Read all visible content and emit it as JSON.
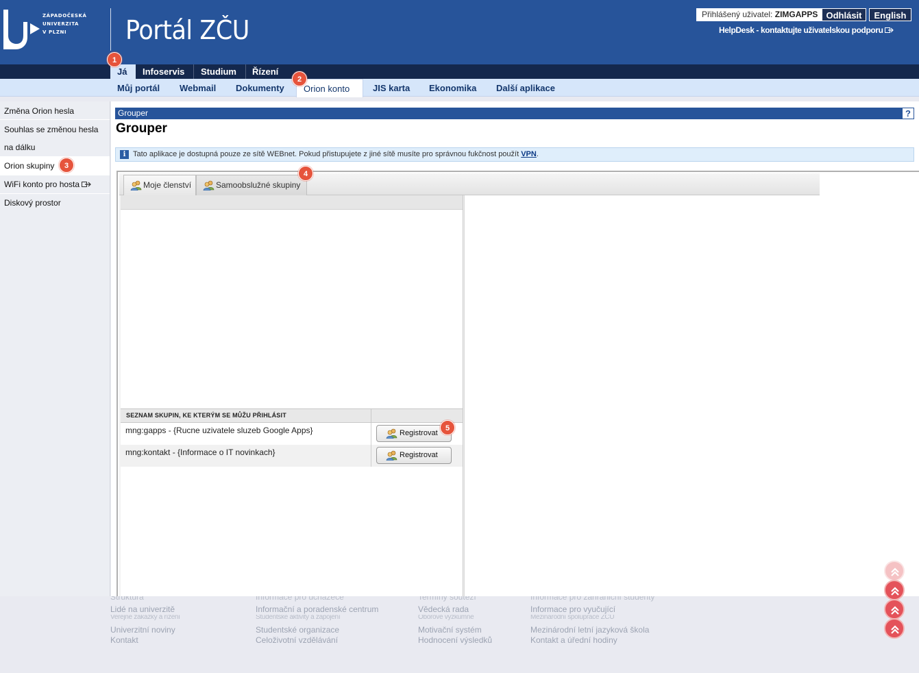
{
  "header": {
    "logo_lines": [
      "ZÁPADOČESKÁ",
      "UNIVERZITA",
      "V PLZNI"
    ],
    "portal_title": "Portál ZČU",
    "user_label": "Přihlášený uživatel:",
    "user_name": "ZIMGAPPS",
    "logout": "Odhlásit",
    "language": "English",
    "helpdesk": "HelpDesk - kontaktujte uživatelskou podporu"
  },
  "topnav": {
    "items": [
      {
        "label": "Já",
        "active": true
      },
      {
        "label": "Infoservis",
        "active": false
      },
      {
        "label": "Studium",
        "active": false
      },
      {
        "label": "Řízení",
        "active": false
      }
    ]
  },
  "subnav": {
    "items": [
      {
        "label": "Můj portál",
        "active": false
      },
      {
        "label": "Webmail",
        "active": false
      },
      {
        "label": "Dokumenty",
        "active": false
      },
      {
        "label": "Orion konto",
        "active": true
      },
      {
        "label": "JIS karta",
        "active": false
      },
      {
        "label": "Ekonomika",
        "active": false
      },
      {
        "label": "Další aplikace",
        "active": false
      }
    ]
  },
  "sidebar": {
    "items": [
      {
        "label": "Změna Orion hesla",
        "active": false
      },
      {
        "label_line1": "Souhlas se změnou hesla",
        "label_line2": "na dálku",
        "active": false
      },
      {
        "label": "Orion skupiny",
        "active": true
      },
      {
        "label": "WiFi konto pro hosta",
        "active": false
      },
      {
        "label": "Diskový prostor",
        "active": false
      }
    ]
  },
  "main": {
    "section_bar": "Grouper",
    "help": "?",
    "title": "Grouper",
    "info_text": "Tato aplikace je dostupná pouze ze sítě WEBnet. Pokud přistupujete z jiné sítě musíte pro správnou fukčnost použít",
    "info_link": "VPN",
    "info_end": ".",
    "tabs": [
      {
        "label": "Moje členství",
        "active": false
      },
      {
        "label": "Samoobslužné skupiny",
        "active": true
      }
    ],
    "groups_header": "SEZNAM SKUPIN, KE KTERÝM SE MŮŽU PŘIHLÁSIT",
    "groups": [
      {
        "name": "mng:gapps - {Rucne uzivatele sluzeb Google Apps}",
        "action": "Registrovat"
      },
      {
        "name": "mng:kontakt - {Informace o IT novinkach}",
        "action": "Registrovat"
      }
    ]
  },
  "footer": {
    "col1": [
      "Struktura",
      "Lidé na univerzitě",
      "Veřejné zakázky a řízení",
      "Univerzitní noviny",
      "Kontakt"
    ],
    "col2": [
      "Informace pro uchazeče",
      "Informační a poradenské centrum",
      "Studentské aktivity a zapojení",
      "Studentské organizace",
      "Celoživotní vzdělávání"
    ],
    "col3": [
      "Termíny soutěží",
      "Vědecká rada",
      "Oborové výzkumné",
      "Motivační systém",
      "Hodnocení výsledků"
    ],
    "col4": [
      "Informace pro zahraniční studenty",
      "Informace pro vyučující",
      "Mezinárodní spolupráce ZČU",
      "Mezinárodní letní jazyková škola",
      "Kontakt a úřední hodiny"
    ]
  },
  "badges": [
    "1",
    "2",
    "3",
    "4",
    "5"
  ],
  "colors": {
    "header_blue": "#27549a",
    "nav_dark": "#14284d",
    "subnav_light": "#d6e6fa",
    "badge": "#e6543c",
    "scroll_button": "#e4525a"
  }
}
